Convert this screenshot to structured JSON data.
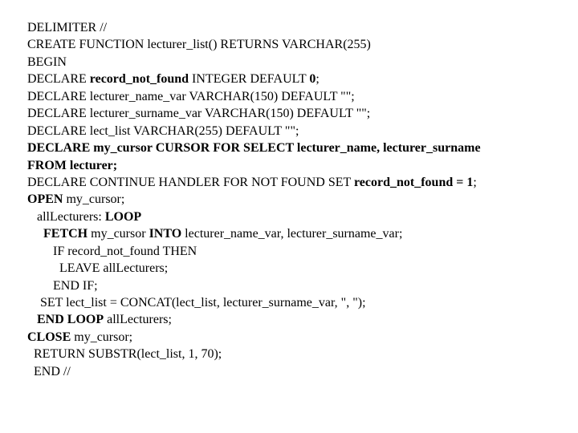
{
  "code": {
    "l0_a": "DELIMITER //",
    "l1_a": "CREATE FUNCTION lecturer_list() RETURNS VARCHAR(255)",
    "l2_a": "BEGIN",
    "l3_a": "DECLARE ",
    "l3_b": "record_not_found",
    "l3_c": " INTEGER DEFAULT ",
    "l3_d": "0",
    "l3_e": ";",
    "l4_a": "DECLARE lecturer_name_var VARCHAR(150) DEFAULT \"\";",
    "l5_a": "DECLARE lecturer_surname_var VARCHAR(150) DEFAULT \"\";",
    "l6_a": "DECLARE lect_list VARCHAR(255) DEFAULT \"\";",
    "l7_a": "DECLARE my_cursor CURSOR FOR SELECT lecturer_name, lecturer_surname",
    "l8_a": "FROM lecturer;",
    "l9_a": "DECLARE CONTINUE HANDLER FOR NOT FOUND SET ",
    "l9_b": "record_not_found = 1",
    "l9_c": ";",
    "l10_a": "OPEN",
    "l10_b": " my_cursor;",
    "l11_a": "   allLecturers: ",
    "l11_b": "LOOP",
    "l12_a": "     ",
    "l12_b": "FETCH",
    "l12_c": " my_cursor ",
    "l12_d": "INTO",
    "l12_e": " lecturer_name_var, lecturer_surname_var;",
    "l13_a": "        IF record_not_found THEN",
    "l14_a": "          LEAVE allLecturers;",
    "l15_a": "        END IF;",
    "l16_a": "    SET lect_list = CONCAT(lect_list, lecturer_surname_var, \", \");",
    "l17_a": "   ",
    "l17_b": "END LOOP",
    "l17_c": " allLecturers;",
    "l18_a": "CLOSE",
    "l18_b": " my_cursor;",
    "l19_a": "  RETURN SUBSTR(lect_list, 1, 70);",
    "l20_a": "  END //"
  }
}
